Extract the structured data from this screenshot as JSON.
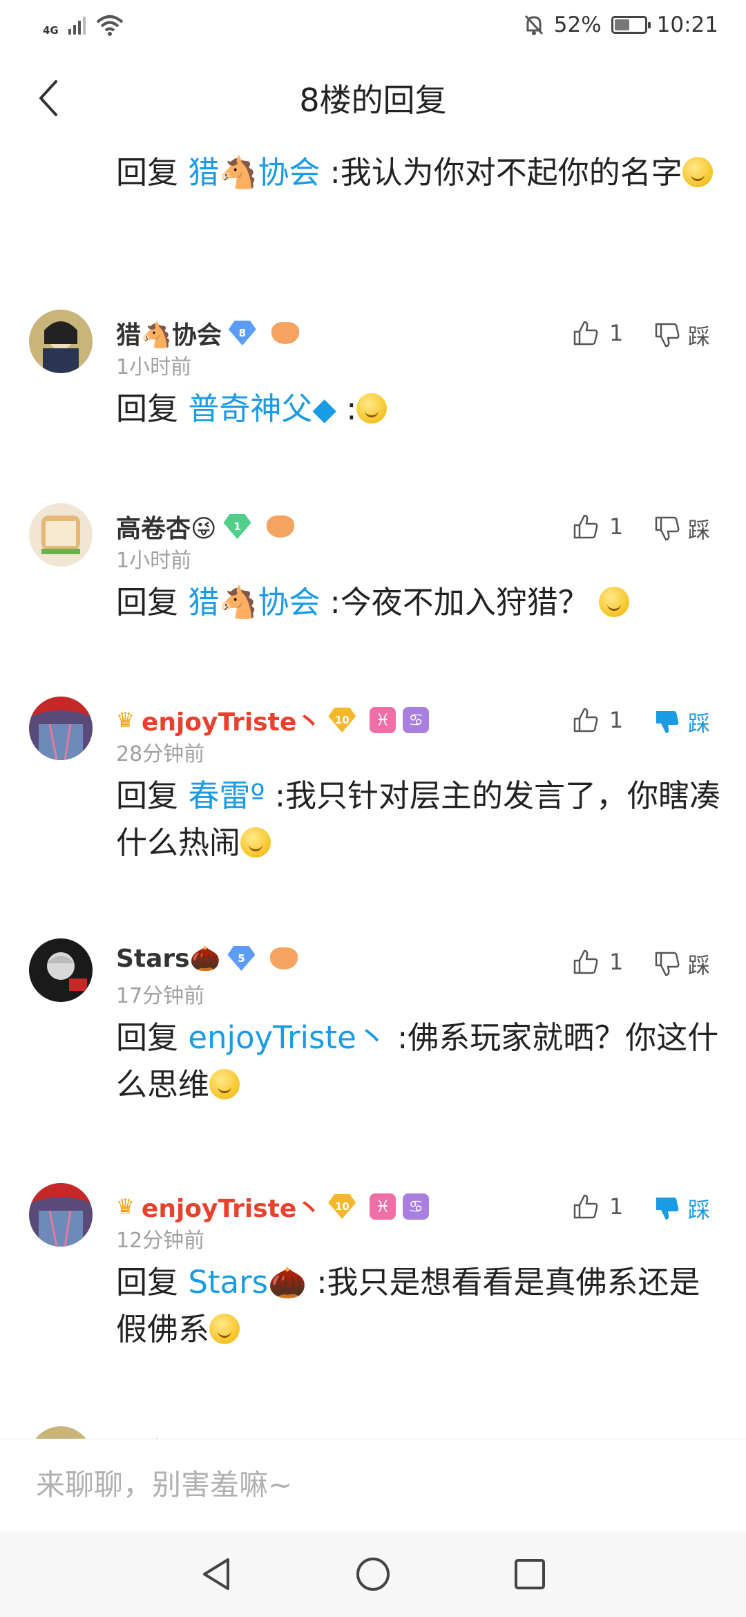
{
  "status_bar": {
    "network": "4G",
    "battery": "52%",
    "battery_level": 0.52,
    "time": "10:21"
  },
  "header": {
    "title": "8楼的回复"
  },
  "top_reply": {
    "prefix": "回复 ",
    "mention": "猎🐴协会",
    "text": " :我认为你对不起你的名字"
  },
  "comments": [
    {
      "username": "猎🐴协会",
      "level": "8",
      "time": "1小时前",
      "likes": "1",
      "dislike_label": "踩",
      "reply_prefix": "回复 ",
      "mention": "普奇神父◆",
      "text": " :"
    },
    {
      "username": "高卷杏😜",
      "level": "1",
      "time": "1小时前",
      "likes": "1",
      "dislike_label": "踩",
      "reply_prefix": "回复 ",
      "mention": "猎🐴协会",
      "text": " :今夜不加入狩猎？"
    },
    {
      "username": "enjoyTriste丶",
      "level": "10",
      "zodiac1": "♓",
      "zodiac2": "♋",
      "time": "28分钟前",
      "likes": "1",
      "dislike_label": "踩",
      "reply_prefix": "回复 ",
      "mention": "春雷º",
      "text": " :我只针对层主的发言了，你瞎凑什么热闹"
    },
    {
      "username": "Stars🌰",
      "level": "5",
      "time": "17分钟前",
      "likes": "1",
      "dislike_label": "踩",
      "reply_prefix": "回复 ",
      "mention": "enjoyTriste丶",
      "text": " :佛系玩家就晒？你这什么思维"
    },
    {
      "username": "enjoyTriste丶",
      "level": "10",
      "zodiac1": "♓",
      "zodiac2": "♋",
      "time": "12分钟前",
      "likes": "1",
      "dislike_label": "踩",
      "reply_prefix": "回复 ",
      "mention": "Stars🌰",
      "text": " :我只是想看看是真佛系还是假佛系"
    },
    {
      "username": "猎🐴协会"
    }
  ],
  "input": {
    "placeholder": "来聊聊，别害羞嘛~"
  },
  "icons": {
    "back": "chevron-left-icon",
    "like": "thumbs-up-icon",
    "dislike": "thumbs-down-icon",
    "nav_back": "triangle-back-icon",
    "nav_home": "circle-home-icon",
    "nav_recent": "square-recent-icon"
  },
  "colors": {
    "accent": "#1a9be6",
    "red_name": "#e8412e",
    "gray_text": "#a0a0a0"
  }
}
